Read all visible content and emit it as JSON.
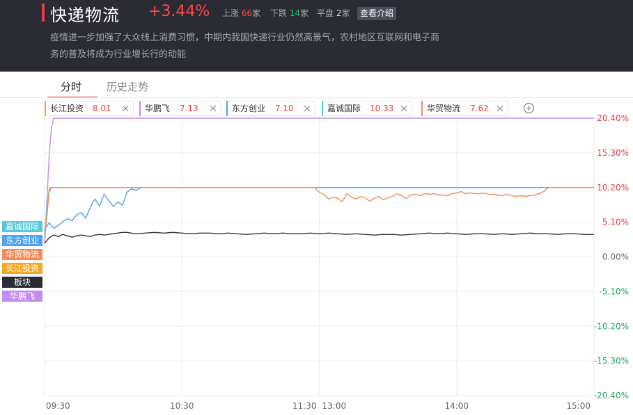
{
  "header": {
    "title": "快递物流",
    "change": "+3.44%",
    "up_label": "上涨",
    "up_count": "66",
    "down_label": "下跌",
    "down_count": "14",
    "flat_label": "平盘",
    "flat_count": "2",
    "unit": "家",
    "intro_button": "查看介绍",
    "description_line1": "疫情进一步加强了大众线上消费习惯，中期内我国快递行业仍然高景气，农村地区互联网和电子商",
    "description_line2": "务的普及将成为行业增长行的动能"
  },
  "tabs": [
    {
      "label": "分时",
      "active": true
    },
    {
      "label": "历史走势",
      "active": false
    }
  ],
  "stocks": [
    {
      "name": "长江投资",
      "price": "8.01",
      "color": "#f6a623"
    },
    {
      "name": "华鹏飞",
      "price": "7.13",
      "color": "#c38df0"
    },
    {
      "name": "东方创业",
      "price": "7.10",
      "color": "#4aa3f5"
    },
    {
      "name": "嘉诚国际",
      "price": "10.33",
      "color": "#55c8dc"
    },
    {
      "name": "华贸物流",
      "price": "7.62",
      "color": "#f6895a"
    }
  ],
  "legend": [
    {
      "label": "嘉诚国际",
      "color": "#55c8dc"
    },
    {
      "label": "东方创业",
      "color": "#4aa3f5"
    },
    {
      "label": "华贸物流",
      "color": "#f6895a"
    },
    {
      "label": "长江投资",
      "color": "#f6a623"
    },
    {
      "label": "板块",
      "color": "#2b2b34"
    },
    {
      "label": "华鹏飞",
      "color": "#c38df0"
    }
  ],
  "chart_data": {
    "type": "line",
    "x_ticks": [
      "09:30",
      "10:30",
      "11:30",
      "13:00",
      "14:00",
      "15:00"
    ],
    "y_ticks": [
      {
        "label": "20.40%",
        "value": 20.4,
        "color": "#e6403f"
      },
      {
        "label": "15.30%",
        "value": 15.3,
        "color": "#e6403f"
      },
      {
        "label": "10.20%",
        "value": 10.2,
        "color": "#e6403f"
      },
      {
        "label": "5.10%",
        "value": 5.1,
        "color": "#e6403f"
      },
      {
        "label": "0.00%",
        "value": 0,
        "color": "#666666"
      },
      {
        "label": "-5.10%",
        "value": -5.1,
        "color": "#1aa863"
      },
      {
        "label": "-10.20%",
        "value": -10.2,
        "color": "#1aa863"
      },
      {
        "label": "-15.30%",
        "value": -15.3,
        "color": "#1aa863"
      },
      {
        "label": "-20.40%",
        "value": -20.4,
        "color": "#1aa863"
      }
    ],
    "ylim": [
      -20.4,
      20.4
    ],
    "xlim": [
      0,
      240
    ],
    "grid": true,
    "series": [
      {
        "name": "华鹏飞",
        "color": "#c38df0",
        "points": [
          [
            0,
            2
          ],
          [
            1,
            8
          ],
          [
            2,
            15
          ],
          [
            3,
            19
          ],
          [
            4,
            20.4
          ],
          [
            240,
            20.4
          ]
        ]
      },
      {
        "name": "长江投资",
        "color": "#f6a623",
        "points": [
          [
            0,
            3
          ],
          [
            1,
            6
          ],
          [
            2,
            10
          ],
          [
            3,
            10.2
          ],
          [
            240,
            10.2
          ]
        ]
      },
      {
        "name": "嘉诚国际",
        "color": "#55c8dc",
        "points": [
          [
            0,
            3
          ],
          [
            1,
            7
          ],
          [
            2,
            9.8
          ],
          [
            3,
            10.2
          ],
          [
            240,
            10.2
          ]
        ]
      },
      {
        "name": "东方创业",
        "color": "#4aa3f5",
        "points": [
          [
            0,
            4
          ],
          [
            2,
            5
          ],
          [
            4,
            4.2
          ],
          [
            6,
            4.6
          ],
          [
            8,
            5.2
          ],
          [
            10,
            5.6
          ],
          [
            12,
            5.3
          ],
          [
            14,
            6.2
          ],
          [
            16,
            6.5
          ],
          [
            18,
            5.7
          ],
          [
            20,
            7.3
          ],
          [
            22,
            8.5
          ],
          [
            24,
            7.5
          ],
          [
            26,
            9.2
          ],
          [
            28,
            8.3
          ],
          [
            30,
            7.4
          ],
          [
            32,
            8.1
          ],
          [
            34,
            7.6
          ],
          [
            36,
            9.5
          ],
          [
            38,
            10.0
          ],
          [
            40,
            9.8
          ],
          [
            42,
            10.2
          ],
          [
            240,
            10.2
          ]
        ]
      },
      {
        "name": "华贸物流",
        "color": "#f6895a",
        "points": [
          [
            0,
            2
          ],
          [
            1,
            6
          ],
          [
            2,
            9.5
          ],
          [
            3,
            10.2
          ],
          [
            118,
            10.2
          ],
          [
            120,
            9.5
          ],
          [
            122,
            9.2
          ],
          [
            124,
            8.5
          ],
          [
            126,
            8.8
          ],
          [
            128,
            8.6
          ],
          [
            130,
            8.1
          ],
          [
            132,
            9.3
          ],
          [
            134,
            8.8
          ],
          [
            136,
            8.5
          ],
          [
            138,
            8.9
          ],
          [
            140,
            8.7
          ],
          [
            142,
            8.2
          ],
          [
            144,
            8.6
          ],
          [
            146,
            8.9
          ],
          [
            148,
            8.4
          ],
          [
            150,
            8.7
          ],
          [
            152,
            8.9
          ],
          [
            154,
            9.3
          ],
          [
            156,
            9.0
          ],
          [
            158,
            8.6
          ],
          [
            160,
            9.1
          ],
          [
            162,
            9.2
          ],
          [
            164,
            9.0
          ],
          [
            166,
            9.3
          ],
          [
            168,
            9.2
          ],
          [
            170,
            9.3
          ],
          [
            172,
            9.1
          ],
          [
            174,
            9.1
          ],
          [
            176,
            9.0
          ],
          [
            178,
            9.3
          ],
          [
            180,
            9.4
          ],
          [
            182,
            9.6
          ],
          [
            184,
            9.3
          ],
          [
            186,
            9.4
          ],
          [
            188,
            9.3
          ],
          [
            190,
            9.3
          ],
          [
            192,
            9.4
          ],
          [
            194,
            9.2
          ],
          [
            196,
            9.2
          ],
          [
            198,
            9.1
          ],
          [
            200,
            9.0
          ],
          [
            202,
            9.2
          ],
          [
            204,
            9.0
          ],
          [
            206,
            8.9
          ],
          [
            208,
            9.0
          ],
          [
            210,
            8.9
          ],
          [
            212,
            9.0
          ],
          [
            214,
            9.1
          ],
          [
            216,
            9.3
          ],
          [
            218,
            9.6
          ],
          [
            220,
            10.2
          ],
          [
            240,
            10.2
          ]
        ]
      },
      {
        "name": "板块",
        "color": "#333333",
        "points": [
          [
            0,
            2
          ],
          [
            2,
            2.8
          ],
          [
            4,
            3.2
          ],
          [
            6,
            3.0
          ],
          [
            8,
            3.3
          ],
          [
            10,
            3.1
          ],
          [
            12,
            2.9
          ],
          [
            14,
            3.1
          ],
          [
            16,
            3.2
          ],
          [
            18,
            3.1
          ],
          [
            20,
            3.0
          ],
          [
            22,
            3.2
          ],
          [
            24,
            3.3
          ],
          [
            26,
            3.2
          ],
          [
            28,
            3.3
          ],
          [
            30,
            3.4
          ],
          [
            32,
            3.5
          ],
          [
            34,
            3.6
          ],
          [
            36,
            3.6
          ],
          [
            38,
            3.5
          ],
          [
            40,
            3.4
          ],
          [
            44,
            3.5
          ],
          [
            48,
            3.6
          ],
          [
            52,
            3.5
          ],
          [
            56,
            3.6
          ],
          [
            60,
            3.5
          ],
          [
            64,
            3.4
          ],
          [
            68,
            3.5
          ],
          [
            72,
            3.5
          ],
          [
            76,
            3.4
          ],
          [
            80,
            3.5
          ],
          [
            84,
            3.4
          ],
          [
            88,
            3.3
          ],
          [
            92,
            3.4
          ],
          [
            96,
            3.5
          ],
          [
            100,
            3.4
          ],
          [
            104,
            3.5
          ],
          [
            108,
            3.4
          ],
          [
            112,
            3.4
          ],
          [
            116,
            3.5
          ],
          [
            120,
            3.4
          ],
          [
            124,
            3.5
          ],
          [
            128,
            3.4
          ],
          [
            132,
            3.3
          ],
          [
            136,
            3.4
          ],
          [
            140,
            3.3
          ],
          [
            144,
            3.2
          ],
          [
            148,
            3.3
          ],
          [
            152,
            3.3
          ],
          [
            156,
            3.2
          ],
          [
            160,
            3.3
          ],
          [
            164,
            3.4
          ],
          [
            168,
            3.5
          ],
          [
            172,
            3.4
          ],
          [
            176,
            3.5
          ],
          [
            180,
            3.4
          ],
          [
            184,
            3.3
          ],
          [
            188,
            3.4
          ],
          [
            192,
            3.4
          ],
          [
            196,
            3.3
          ],
          [
            200,
            3.4
          ],
          [
            204,
            3.3
          ],
          [
            208,
            3.4
          ],
          [
            212,
            3.5
          ],
          [
            216,
            3.4
          ],
          [
            220,
            3.4
          ],
          [
            224,
            3.3
          ],
          [
            228,
            3.4
          ],
          [
            232,
            3.4
          ],
          [
            236,
            3.3
          ],
          [
            240,
            3.3
          ]
        ]
      }
    ]
  }
}
